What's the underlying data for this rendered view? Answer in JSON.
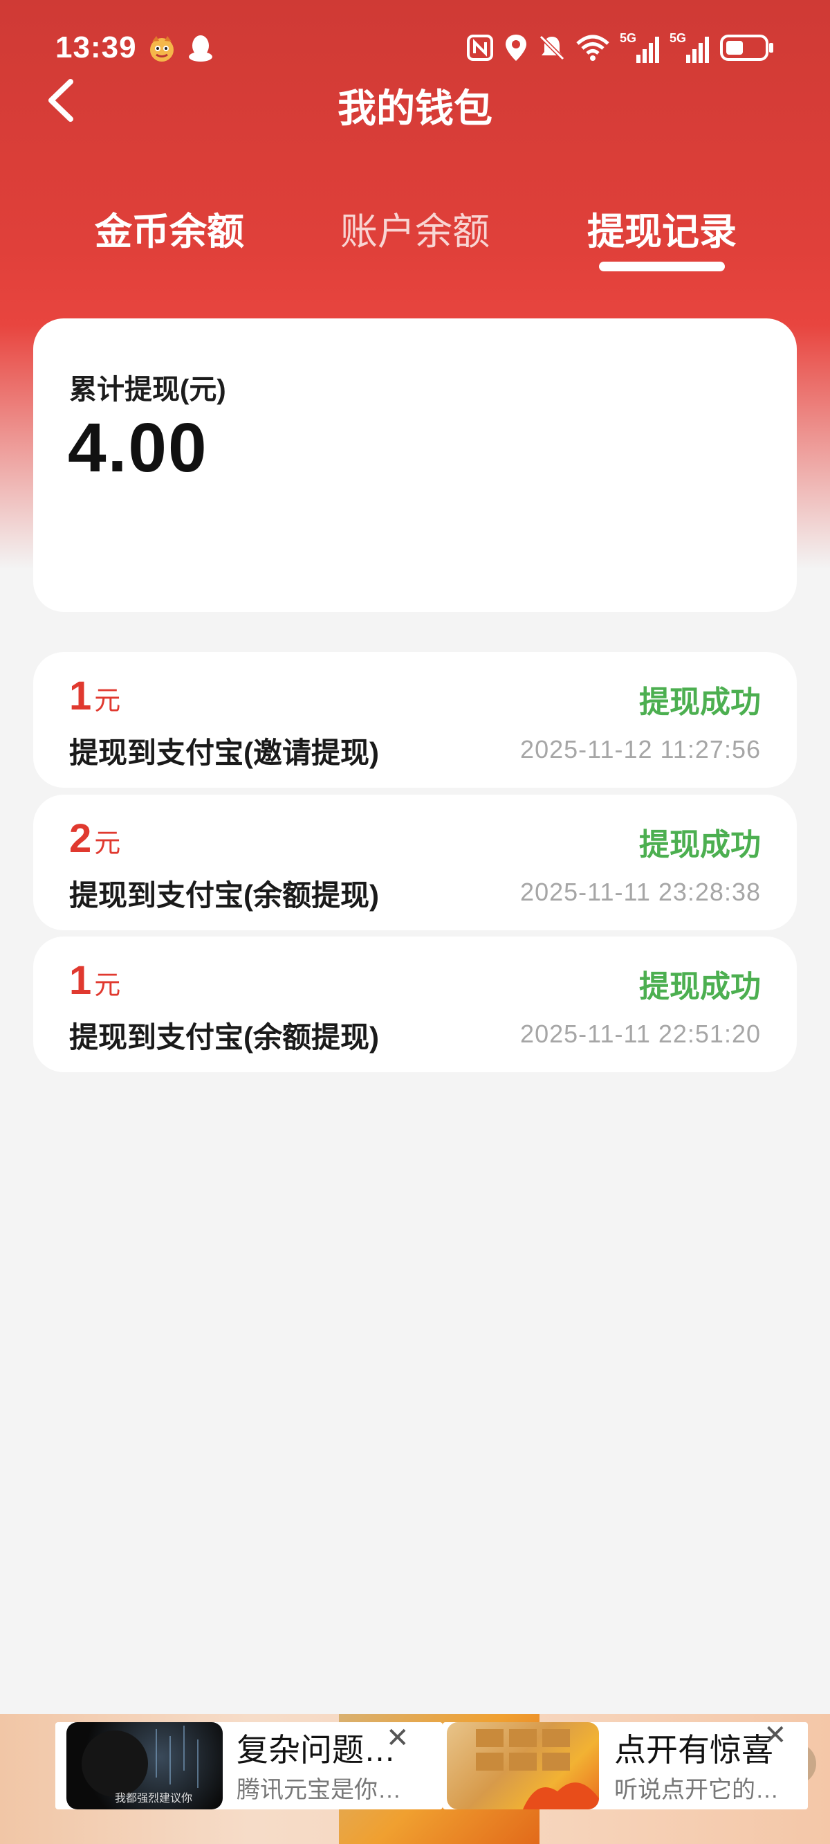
{
  "status_bar": {
    "time": "13:39",
    "signal_label": "5G"
  },
  "nav": {
    "title": "我的钱包"
  },
  "tabs": [
    {
      "label": "金币余额"
    },
    {
      "label": "账户余额"
    },
    {
      "label": "提现记录"
    }
  ],
  "summary": {
    "label": "累计提现(元)",
    "value": "4.00"
  },
  "records": [
    {
      "amount": "1",
      "unit": "元",
      "desc": "提现到支付宝(邀请提现)",
      "status": "提现成功",
      "time": "2025-11-12 11:27:56"
    },
    {
      "amount": "2",
      "unit": "元",
      "desc": "提现到支付宝(余额提现)",
      "status": "提现成功",
      "time": "2025-11-11 23:28:38"
    },
    {
      "amount": "1",
      "unit": "元",
      "desc": "提现到支付宝(余额提现)",
      "status": "提现成功",
      "time": "2025-11-11 22:51:20"
    }
  ],
  "ads": [
    {
      "title": "复杂问题…",
      "subtitle": "腾讯元宝是你…",
      "thumb_caption": "我都强烈建议你"
    },
    {
      "title": "点开有惊喜",
      "subtitle": "听说点开它的…"
    }
  ],
  "colors": {
    "header_red": "#e0403a",
    "amount_red": "#e0392f",
    "success_green": "#4caf50",
    "time_gray": "#a6a6a6"
  }
}
